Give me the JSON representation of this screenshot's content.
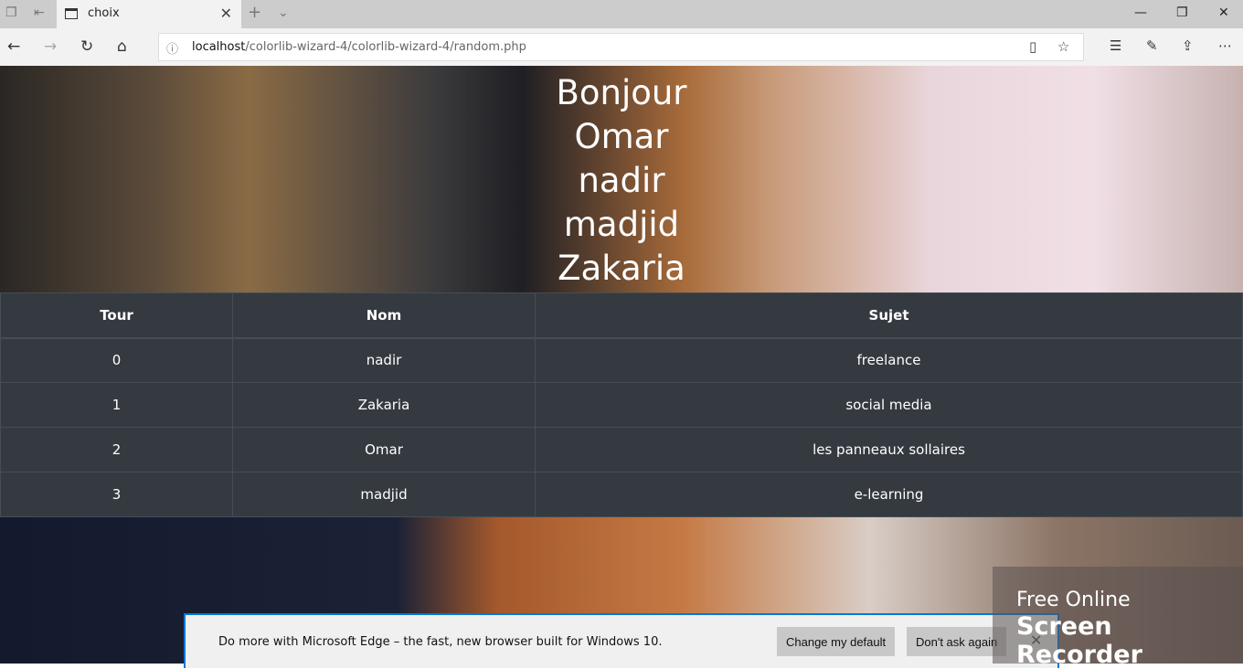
{
  "browser": {
    "tab_title": "choix",
    "url_host": "localhost",
    "url_path": "/colorlib-wizard-4/colorlib-wizard-4/random.php"
  },
  "greeting": [
    "Bonjour",
    "Omar",
    "nadir",
    "madjid",
    "Zakaria"
  ],
  "table": {
    "headers": [
      "Tour",
      "Nom",
      "Sujet"
    ],
    "rows": [
      [
        "0",
        "nadir",
        "freelance"
      ],
      [
        "1",
        "Zakaria",
        "social media"
      ],
      [
        "2",
        "Omar",
        "les panneaux sollaires"
      ],
      [
        "3",
        "madjid",
        "e-learning"
      ]
    ]
  },
  "edge_bar": {
    "message": "Do more with Microsoft Edge – the fast, new browser built for Windows 10.",
    "change_default": "Change my default",
    "dont_ask": "Don't ask again"
  },
  "watermark": {
    "line1": "Free Online",
    "line2": "Screen Recorder"
  }
}
